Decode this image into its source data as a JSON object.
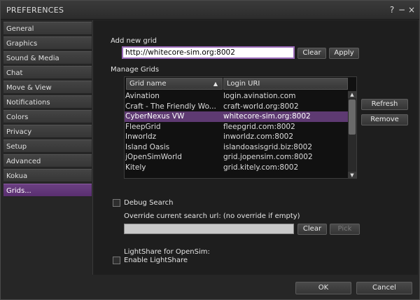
{
  "window": {
    "title": "PREFERENCES",
    "help": "?",
    "minimize": "−",
    "close": "×"
  },
  "sidebar": {
    "items": [
      {
        "label": "General"
      },
      {
        "label": "Graphics"
      },
      {
        "label": "Sound & Media"
      },
      {
        "label": "Chat"
      },
      {
        "label": "Move & View"
      },
      {
        "label": "Notifications"
      },
      {
        "label": "Colors"
      },
      {
        "label": "Privacy"
      },
      {
        "label": "Setup"
      },
      {
        "label": "Advanced"
      },
      {
        "label": "Kokua"
      },
      {
        "label": "Grids..."
      }
    ],
    "active": "Grids..."
  },
  "add_grid": {
    "label": "Add new grid",
    "value": "http://whitecore-sim.org:8002",
    "clear": "Clear",
    "apply": "Apply"
  },
  "manage": {
    "label": "Manage Grids",
    "col_name": "Grid name",
    "col_uri": "Login URI",
    "sort_icon": "▲",
    "rows": [
      {
        "name": "Avination",
        "uri": "login.avination.com"
      },
      {
        "name": "Craft - The Friendly Wo...",
        "uri": "craft-world.org:8002"
      },
      {
        "name": "CyberNexus VW",
        "uri": "whitecore-sim.org:8002",
        "selected": true
      },
      {
        "name": "FleepGrid",
        "uri": "fleepgrid.com:8002"
      },
      {
        "name": "Inworldz",
        "uri": "inworldz.com:8002"
      },
      {
        "name": "Island Oasis",
        "uri": "islandoasisgrid.biz:8002"
      },
      {
        "name": "jOpenSimWorld",
        "uri": "grid.jopensim.com:8002"
      },
      {
        "name": "Kitely",
        "uri": "grid.kitely.com:8002"
      }
    ],
    "refresh": "Refresh",
    "remove": "Remove",
    "scroll_up": "▲",
    "scroll_down": "▼"
  },
  "search": {
    "debug_label": "Debug Search",
    "override_label": "Override current search url: (no override if empty)",
    "value": "",
    "clear": "Clear",
    "pick": "Pick"
  },
  "lightshare": {
    "heading": "LightShare for OpenSim:",
    "enable_label": "Enable LightShare"
  },
  "footer": {
    "ok": "OK",
    "cancel": "Cancel"
  }
}
